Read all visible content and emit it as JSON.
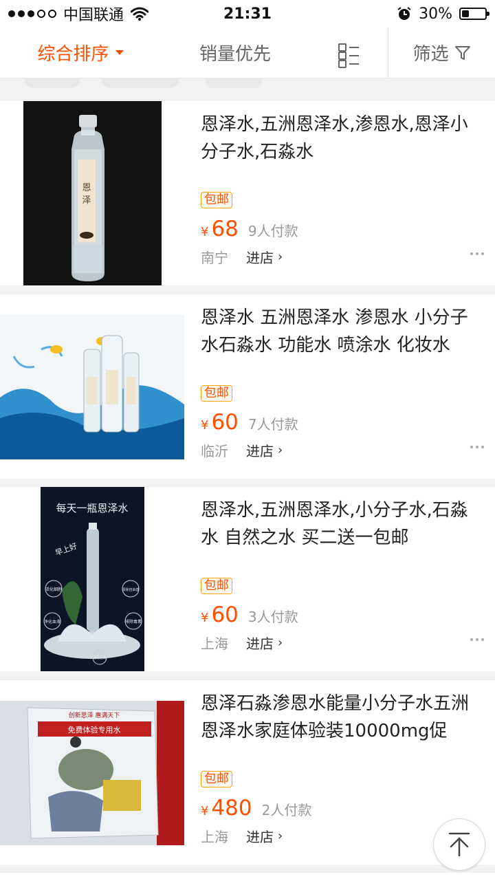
{
  "status_bar": {
    "carrier": "中国联通",
    "time": "21:31",
    "battery_percent": "30%",
    "battery_level": 0.3
  },
  "tabs": {
    "sort_label": "综合排序",
    "sales_label": "销量优先",
    "filter_label": "筛选"
  },
  "currency_symbol": "¥",
  "store_link_label": "进店",
  "products": [
    {
      "title": "恩泽水,五洲恩泽水,渗恩水,恩泽小分子水,石淼水",
      "badge": "包邮",
      "price": "68",
      "sales": "9人付款",
      "location": "南宁"
    },
    {
      "title": "恩泽水 五洲恩泽水 渗恩水 小分子水石淼水 功能水 喷涂水 化妆水",
      "badge": "包邮",
      "price": "60",
      "sales": "7人付款",
      "location": "临沂"
    },
    {
      "title": "恩泽水,五洲恩泽水,小分子水,石淼水 自然之水 买二送一包邮",
      "badge": "包邮",
      "price": "60",
      "sales": "3人付款",
      "location": "上海",
      "image_text": {
        "headline": "每天一瓶恩泽水",
        "sticker": "早上好",
        "features": [
          "活化细胞",
          "清除自由基",
          "净化血液",
          "排除毒素",
          "活化色斑"
        ]
      }
    },
    {
      "title": "恩泽石淼渗恩水能量小分子水五洲恩泽水家庭体验装10000mg促",
      "badge": "包邮",
      "price": "480",
      "sales": "2人付款",
      "location": "上海",
      "image_text": {
        "banner": "免费体验专用水",
        "top_line": "创新思泽 惠满天下"
      }
    }
  ]
}
